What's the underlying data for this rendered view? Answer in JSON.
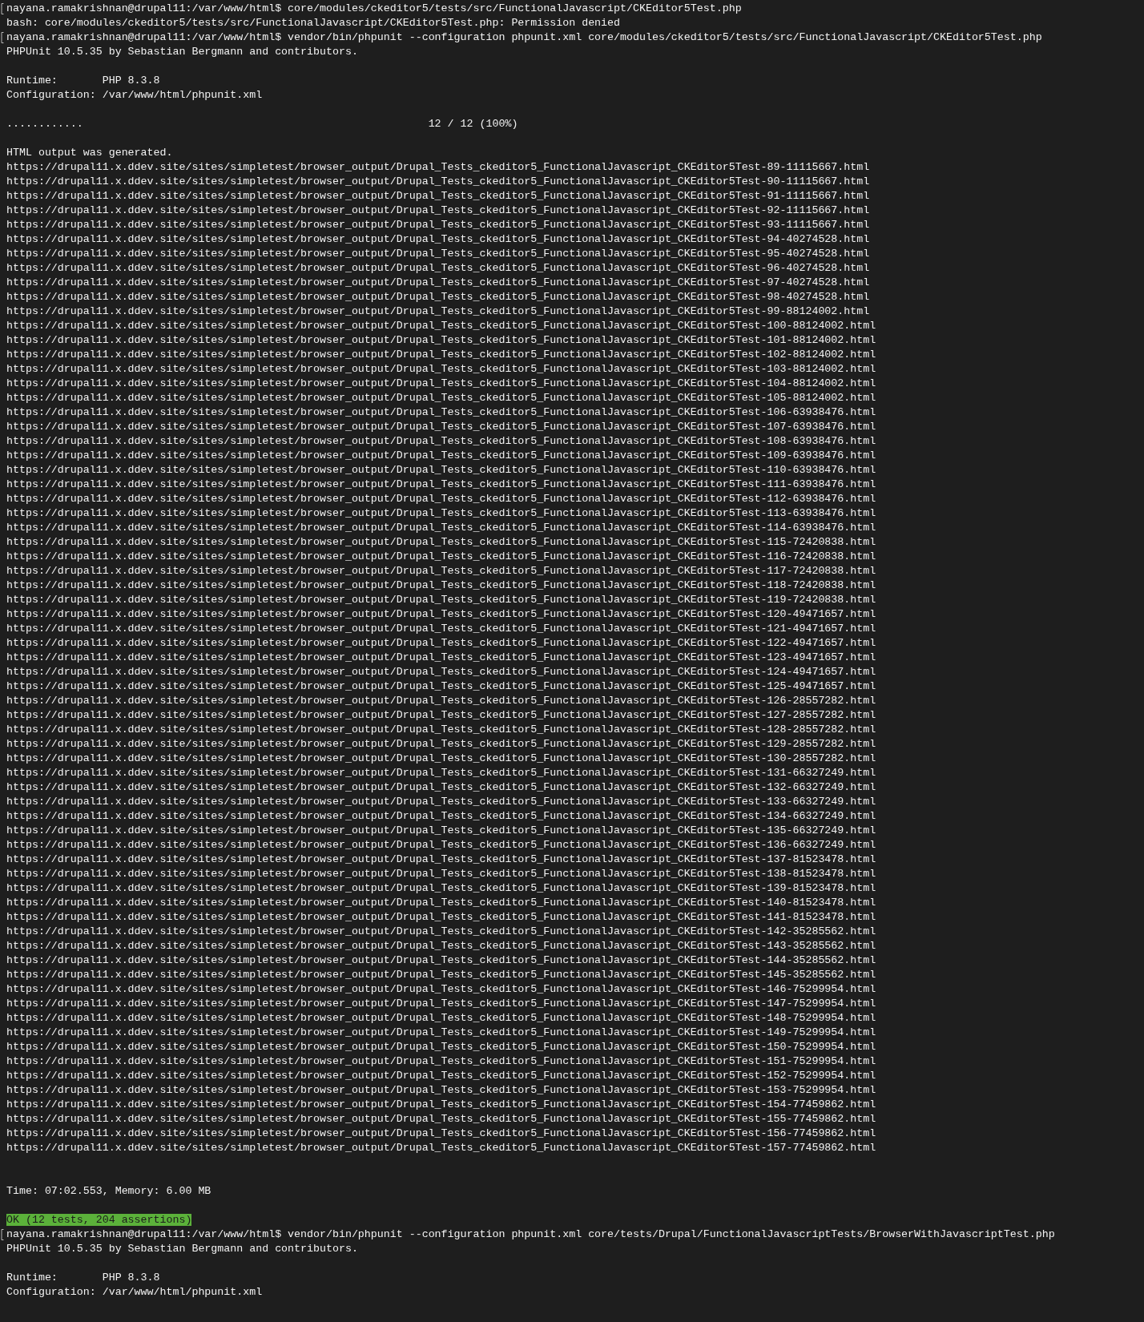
{
  "terminal": {
    "lines": [
      {
        "kind": "prompt",
        "text": "nayana.ramakrishnan@drupal11:/var/www/html$ core/modules/ckeditor5/tests/src/FunctionalJavascript/CKEditor5Test.php"
      },
      {
        "kind": "output",
        "text": "bash: core/modules/ckeditor5/tests/src/FunctionalJavascript/CKEditor5Test.php: Permission denied"
      },
      {
        "kind": "prompt",
        "text": "nayana.ramakrishnan@drupal11:/var/www/html$ vendor/bin/phpunit --configuration phpunit.xml core/modules/ckeditor5/tests/src/FunctionalJavascript/CKEditor5Test.php"
      },
      {
        "kind": "output",
        "text": "PHPUnit 10.5.35 by Sebastian Bergmann and contributors."
      },
      {
        "kind": "blank"
      },
      {
        "kind": "output",
        "text": "Runtime:       PHP 8.3.8"
      },
      {
        "kind": "output",
        "text": "Configuration: /var/www/html/phpunit.xml"
      },
      {
        "kind": "blank"
      },
      {
        "kind": "output",
        "text": "............                                                      12 / 12 (100%)"
      },
      {
        "kind": "blank"
      },
      {
        "kind": "output",
        "text": "HTML output was generated."
      },
      {
        "kind": "output",
        "text": "https://drupal11.x.ddev.site/sites/simpletest/browser_output/Drupal_Tests_ckeditor5_FunctionalJavascript_CKEditor5Test-89-11115667.html"
      },
      {
        "kind": "output",
        "text": "https://drupal11.x.ddev.site/sites/simpletest/browser_output/Drupal_Tests_ckeditor5_FunctionalJavascript_CKEditor5Test-90-11115667.html"
      },
      {
        "kind": "output",
        "text": "https://drupal11.x.ddev.site/sites/simpletest/browser_output/Drupal_Tests_ckeditor5_FunctionalJavascript_CKEditor5Test-91-11115667.html"
      },
      {
        "kind": "output",
        "text": "https://drupal11.x.ddev.site/sites/simpletest/browser_output/Drupal_Tests_ckeditor5_FunctionalJavascript_CKEditor5Test-92-11115667.html"
      },
      {
        "kind": "output",
        "text": "https://drupal11.x.ddev.site/sites/simpletest/browser_output/Drupal_Tests_ckeditor5_FunctionalJavascript_CKEditor5Test-93-11115667.html"
      },
      {
        "kind": "output",
        "text": "https://drupal11.x.ddev.site/sites/simpletest/browser_output/Drupal_Tests_ckeditor5_FunctionalJavascript_CKEditor5Test-94-40274528.html"
      },
      {
        "kind": "output",
        "text": "https://drupal11.x.ddev.site/sites/simpletest/browser_output/Drupal_Tests_ckeditor5_FunctionalJavascript_CKEditor5Test-95-40274528.html"
      },
      {
        "kind": "output",
        "text": "https://drupal11.x.ddev.site/sites/simpletest/browser_output/Drupal_Tests_ckeditor5_FunctionalJavascript_CKEditor5Test-96-40274528.html"
      },
      {
        "kind": "output",
        "text": "https://drupal11.x.ddev.site/sites/simpletest/browser_output/Drupal_Tests_ckeditor5_FunctionalJavascript_CKEditor5Test-97-40274528.html"
      },
      {
        "kind": "output",
        "text": "https://drupal11.x.ddev.site/sites/simpletest/browser_output/Drupal_Tests_ckeditor5_FunctionalJavascript_CKEditor5Test-98-40274528.html"
      },
      {
        "kind": "output",
        "text": "https://drupal11.x.ddev.site/sites/simpletest/browser_output/Drupal_Tests_ckeditor5_FunctionalJavascript_CKEditor5Test-99-88124002.html"
      },
      {
        "kind": "output",
        "text": "https://drupal11.x.ddev.site/sites/simpletest/browser_output/Drupal_Tests_ckeditor5_FunctionalJavascript_CKEditor5Test-100-88124002.html"
      },
      {
        "kind": "output",
        "text": "https://drupal11.x.ddev.site/sites/simpletest/browser_output/Drupal_Tests_ckeditor5_FunctionalJavascript_CKEditor5Test-101-88124002.html"
      },
      {
        "kind": "output",
        "text": "https://drupal11.x.ddev.site/sites/simpletest/browser_output/Drupal_Tests_ckeditor5_FunctionalJavascript_CKEditor5Test-102-88124002.html"
      },
      {
        "kind": "output",
        "text": "https://drupal11.x.ddev.site/sites/simpletest/browser_output/Drupal_Tests_ckeditor5_FunctionalJavascript_CKEditor5Test-103-88124002.html"
      },
      {
        "kind": "output",
        "text": "https://drupal11.x.ddev.site/sites/simpletest/browser_output/Drupal_Tests_ckeditor5_FunctionalJavascript_CKEditor5Test-104-88124002.html"
      },
      {
        "kind": "output",
        "text": "https://drupal11.x.ddev.site/sites/simpletest/browser_output/Drupal_Tests_ckeditor5_FunctionalJavascript_CKEditor5Test-105-88124002.html"
      },
      {
        "kind": "output",
        "text": "https://drupal11.x.ddev.site/sites/simpletest/browser_output/Drupal_Tests_ckeditor5_FunctionalJavascript_CKEditor5Test-106-63938476.html"
      },
      {
        "kind": "output",
        "text": "https://drupal11.x.ddev.site/sites/simpletest/browser_output/Drupal_Tests_ckeditor5_FunctionalJavascript_CKEditor5Test-107-63938476.html"
      },
      {
        "kind": "output",
        "text": "https://drupal11.x.ddev.site/sites/simpletest/browser_output/Drupal_Tests_ckeditor5_FunctionalJavascript_CKEditor5Test-108-63938476.html"
      },
      {
        "kind": "output",
        "text": "https://drupal11.x.ddev.site/sites/simpletest/browser_output/Drupal_Tests_ckeditor5_FunctionalJavascript_CKEditor5Test-109-63938476.html"
      },
      {
        "kind": "output",
        "text": "https://drupal11.x.ddev.site/sites/simpletest/browser_output/Drupal_Tests_ckeditor5_FunctionalJavascript_CKEditor5Test-110-63938476.html"
      },
      {
        "kind": "output",
        "text": "https://drupal11.x.ddev.site/sites/simpletest/browser_output/Drupal_Tests_ckeditor5_FunctionalJavascript_CKEditor5Test-111-63938476.html"
      },
      {
        "kind": "output",
        "text": "https://drupal11.x.ddev.site/sites/simpletest/browser_output/Drupal_Tests_ckeditor5_FunctionalJavascript_CKEditor5Test-112-63938476.html"
      },
      {
        "kind": "output",
        "text": "https://drupal11.x.ddev.site/sites/simpletest/browser_output/Drupal_Tests_ckeditor5_FunctionalJavascript_CKEditor5Test-113-63938476.html"
      },
      {
        "kind": "output",
        "text": "https://drupal11.x.ddev.site/sites/simpletest/browser_output/Drupal_Tests_ckeditor5_FunctionalJavascript_CKEditor5Test-114-63938476.html"
      },
      {
        "kind": "output",
        "text": "https://drupal11.x.ddev.site/sites/simpletest/browser_output/Drupal_Tests_ckeditor5_FunctionalJavascript_CKEditor5Test-115-72420838.html"
      },
      {
        "kind": "output",
        "text": "https://drupal11.x.ddev.site/sites/simpletest/browser_output/Drupal_Tests_ckeditor5_FunctionalJavascript_CKEditor5Test-116-72420838.html"
      },
      {
        "kind": "output",
        "text": "https://drupal11.x.ddev.site/sites/simpletest/browser_output/Drupal_Tests_ckeditor5_FunctionalJavascript_CKEditor5Test-117-72420838.html"
      },
      {
        "kind": "output",
        "text": "https://drupal11.x.ddev.site/sites/simpletest/browser_output/Drupal_Tests_ckeditor5_FunctionalJavascript_CKEditor5Test-118-72420838.html"
      },
      {
        "kind": "output",
        "text": "https://drupal11.x.ddev.site/sites/simpletest/browser_output/Drupal_Tests_ckeditor5_FunctionalJavascript_CKEditor5Test-119-72420838.html"
      },
      {
        "kind": "output",
        "text": "https://drupal11.x.ddev.site/sites/simpletest/browser_output/Drupal_Tests_ckeditor5_FunctionalJavascript_CKEditor5Test-120-49471657.html"
      },
      {
        "kind": "output",
        "text": "https://drupal11.x.ddev.site/sites/simpletest/browser_output/Drupal_Tests_ckeditor5_FunctionalJavascript_CKEditor5Test-121-49471657.html"
      },
      {
        "kind": "output",
        "text": "https://drupal11.x.ddev.site/sites/simpletest/browser_output/Drupal_Tests_ckeditor5_FunctionalJavascript_CKEditor5Test-122-49471657.html"
      },
      {
        "kind": "output",
        "text": "https://drupal11.x.ddev.site/sites/simpletest/browser_output/Drupal_Tests_ckeditor5_FunctionalJavascript_CKEditor5Test-123-49471657.html"
      },
      {
        "kind": "output",
        "text": "https://drupal11.x.ddev.site/sites/simpletest/browser_output/Drupal_Tests_ckeditor5_FunctionalJavascript_CKEditor5Test-124-49471657.html"
      },
      {
        "kind": "output",
        "text": "https://drupal11.x.ddev.site/sites/simpletest/browser_output/Drupal_Tests_ckeditor5_FunctionalJavascript_CKEditor5Test-125-49471657.html"
      },
      {
        "kind": "output",
        "text": "https://drupal11.x.ddev.site/sites/simpletest/browser_output/Drupal_Tests_ckeditor5_FunctionalJavascript_CKEditor5Test-126-28557282.html"
      },
      {
        "kind": "output",
        "text": "https://drupal11.x.ddev.site/sites/simpletest/browser_output/Drupal_Tests_ckeditor5_FunctionalJavascript_CKEditor5Test-127-28557282.html"
      },
      {
        "kind": "output",
        "text": "https://drupal11.x.ddev.site/sites/simpletest/browser_output/Drupal_Tests_ckeditor5_FunctionalJavascript_CKEditor5Test-128-28557282.html"
      },
      {
        "kind": "output",
        "text": "https://drupal11.x.ddev.site/sites/simpletest/browser_output/Drupal_Tests_ckeditor5_FunctionalJavascript_CKEditor5Test-129-28557282.html"
      },
      {
        "kind": "output",
        "text": "https://drupal11.x.ddev.site/sites/simpletest/browser_output/Drupal_Tests_ckeditor5_FunctionalJavascript_CKEditor5Test-130-28557282.html"
      },
      {
        "kind": "output",
        "text": "https://drupal11.x.ddev.site/sites/simpletest/browser_output/Drupal_Tests_ckeditor5_FunctionalJavascript_CKEditor5Test-131-66327249.html"
      },
      {
        "kind": "output",
        "text": "https://drupal11.x.ddev.site/sites/simpletest/browser_output/Drupal_Tests_ckeditor5_FunctionalJavascript_CKEditor5Test-132-66327249.html"
      },
      {
        "kind": "output",
        "text": "https://drupal11.x.ddev.site/sites/simpletest/browser_output/Drupal_Tests_ckeditor5_FunctionalJavascript_CKEditor5Test-133-66327249.html"
      },
      {
        "kind": "output",
        "text": "https://drupal11.x.ddev.site/sites/simpletest/browser_output/Drupal_Tests_ckeditor5_FunctionalJavascript_CKEditor5Test-134-66327249.html"
      },
      {
        "kind": "output",
        "text": "https://drupal11.x.ddev.site/sites/simpletest/browser_output/Drupal_Tests_ckeditor5_FunctionalJavascript_CKEditor5Test-135-66327249.html"
      },
      {
        "kind": "output",
        "text": "https://drupal11.x.ddev.site/sites/simpletest/browser_output/Drupal_Tests_ckeditor5_FunctionalJavascript_CKEditor5Test-136-66327249.html"
      },
      {
        "kind": "output",
        "text": "https://drupal11.x.ddev.site/sites/simpletest/browser_output/Drupal_Tests_ckeditor5_FunctionalJavascript_CKEditor5Test-137-81523478.html"
      },
      {
        "kind": "output",
        "text": "https://drupal11.x.ddev.site/sites/simpletest/browser_output/Drupal_Tests_ckeditor5_FunctionalJavascript_CKEditor5Test-138-81523478.html"
      },
      {
        "kind": "output",
        "text": "https://drupal11.x.ddev.site/sites/simpletest/browser_output/Drupal_Tests_ckeditor5_FunctionalJavascript_CKEditor5Test-139-81523478.html"
      },
      {
        "kind": "output",
        "text": "https://drupal11.x.ddev.site/sites/simpletest/browser_output/Drupal_Tests_ckeditor5_FunctionalJavascript_CKEditor5Test-140-81523478.html"
      },
      {
        "kind": "output",
        "text": "https://drupal11.x.ddev.site/sites/simpletest/browser_output/Drupal_Tests_ckeditor5_FunctionalJavascript_CKEditor5Test-141-81523478.html"
      },
      {
        "kind": "output",
        "text": "https://drupal11.x.ddev.site/sites/simpletest/browser_output/Drupal_Tests_ckeditor5_FunctionalJavascript_CKEditor5Test-142-35285562.html"
      },
      {
        "kind": "output",
        "text": "https://drupal11.x.ddev.site/sites/simpletest/browser_output/Drupal_Tests_ckeditor5_FunctionalJavascript_CKEditor5Test-143-35285562.html"
      },
      {
        "kind": "output",
        "text": "https://drupal11.x.ddev.site/sites/simpletest/browser_output/Drupal_Tests_ckeditor5_FunctionalJavascript_CKEditor5Test-144-35285562.html"
      },
      {
        "kind": "output",
        "text": "https://drupal11.x.ddev.site/sites/simpletest/browser_output/Drupal_Tests_ckeditor5_FunctionalJavascript_CKEditor5Test-145-35285562.html"
      },
      {
        "kind": "output",
        "text": "https://drupal11.x.ddev.site/sites/simpletest/browser_output/Drupal_Tests_ckeditor5_FunctionalJavascript_CKEditor5Test-146-75299954.html"
      },
      {
        "kind": "output",
        "text": "https://drupal11.x.ddev.site/sites/simpletest/browser_output/Drupal_Tests_ckeditor5_FunctionalJavascript_CKEditor5Test-147-75299954.html"
      },
      {
        "kind": "output",
        "text": "https://drupal11.x.ddev.site/sites/simpletest/browser_output/Drupal_Tests_ckeditor5_FunctionalJavascript_CKEditor5Test-148-75299954.html"
      },
      {
        "kind": "output",
        "text": "https://drupal11.x.ddev.site/sites/simpletest/browser_output/Drupal_Tests_ckeditor5_FunctionalJavascript_CKEditor5Test-149-75299954.html"
      },
      {
        "kind": "output",
        "text": "https://drupal11.x.ddev.site/sites/simpletest/browser_output/Drupal_Tests_ckeditor5_FunctionalJavascript_CKEditor5Test-150-75299954.html"
      },
      {
        "kind": "output",
        "text": "https://drupal11.x.ddev.site/sites/simpletest/browser_output/Drupal_Tests_ckeditor5_FunctionalJavascript_CKEditor5Test-151-75299954.html"
      },
      {
        "kind": "output",
        "text": "https://drupal11.x.ddev.site/sites/simpletest/browser_output/Drupal_Tests_ckeditor5_FunctionalJavascript_CKEditor5Test-152-75299954.html"
      },
      {
        "kind": "output",
        "text": "https://drupal11.x.ddev.site/sites/simpletest/browser_output/Drupal_Tests_ckeditor5_FunctionalJavascript_CKEditor5Test-153-75299954.html"
      },
      {
        "kind": "output",
        "text": "https://drupal11.x.ddev.site/sites/simpletest/browser_output/Drupal_Tests_ckeditor5_FunctionalJavascript_CKEditor5Test-154-77459862.html"
      },
      {
        "kind": "output",
        "text": "https://drupal11.x.ddev.site/sites/simpletest/browser_output/Drupal_Tests_ckeditor5_FunctionalJavascript_CKEditor5Test-155-77459862.html"
      },
      {
        "kind": "output",
        "text": "https://drupal11.x.ddev.site/sites/simpletest/browser_output/Drupal_Tests_ckeditor5_FunctionalJavascript_CKEditor5Test-156-77459862.html"
      },
      {
        "kind": "output",
        "text": "https://drupal11.x.ddev.site/sites/simpletest/browser_output/Drupal_Tests_ckeditor5_FunctionalJavascript_CKEditor5Test-157-77459862.html"
      },
      {
        "kind": "blank"
      },
      {
        "kind": "blank"
      },
      {
        "kind": "output",
        "text": "Time: 07:02.553, Memory: 6.00 MB"
      },
      {
        "kind": "blank"
      },
      {
        "kind": "success",
        "text": "OK (12 tests, 204 assertions)"
      },
      {
        "kind": "prompt",
        "text": "nayana.ramakrishnan@drupal11:/var/www/html$ vendor/bin/phpunit --configuration phpunit.xml core/tests/Drupal/FunctionalJavascriptTests/BrowserWithJavascriptTest.php"
      },
      {
        "kind": "output",
        "text": "PHPUnit 10.5.35 by Sebastian Bergmann and contributors."
      },
      {
        "kind": "blank"
      },
      {
        "kind": "output",
        "text": "Runtime:       PHP 8.3.8"
      },
      {
        "kind": "output",
        "text": "Configuration: /var/www/html/phpunit.xml"
      }
    ]
  }
}
